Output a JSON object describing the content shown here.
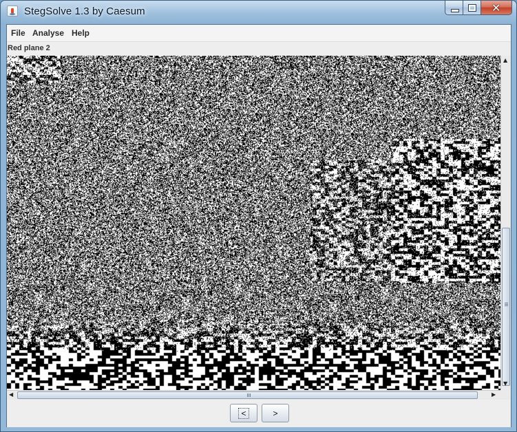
{
  "window": {
    "title": "StegSolve 1.3 by Caesum"
  },
  "menu": {
    "file": "File",
    "analyse": "Analyse",
    "help": "Help"
  },
  "view": {
    "caption": "Red plane 2"
  },
  "nav": {
    "prev_label": "<",
    "next_label": ">"
  },
  "colors": {
    "pixel_on": "#000000",
    "pixel_off": "#ffffff",
    "title_bar": "#9fc0dd",
    "close_button": "#c3422a"
  },
  "icons": {
    "app": "stegsolve-app-icon",
    "minimize": "minimize-icon",
    "maximize": "maximize-icon",
    "close": "close-icon"
  }
}
